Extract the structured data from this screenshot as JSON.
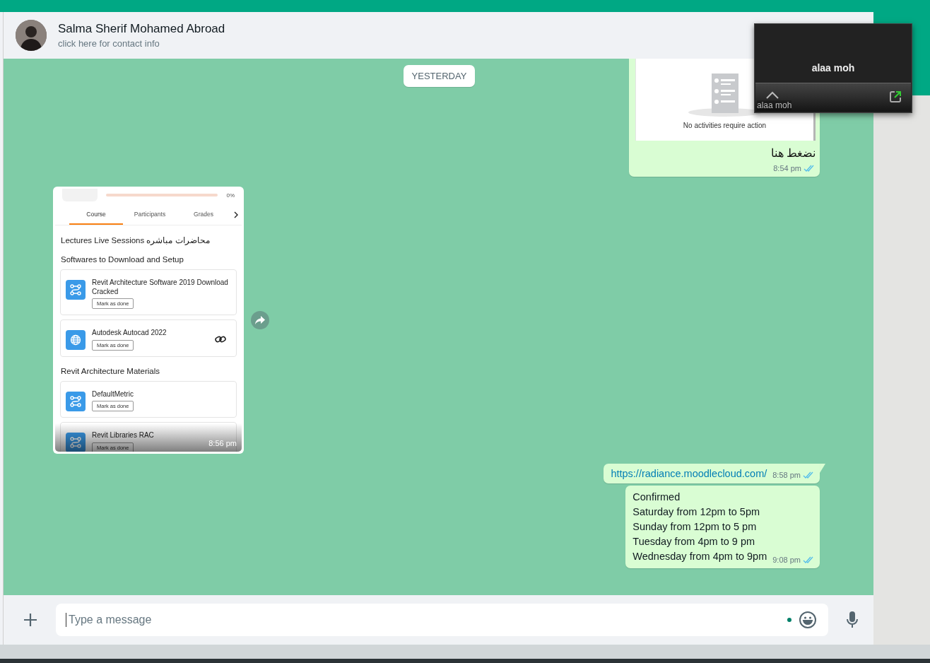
{
  "header": {
    "name": "Salma Sherif Mohamed Abroad",
    "subtitle": "click here for contact info"
  },
  "date_divider": "YESTERDAY",
  "messages": [
    {
      "kind": "image_out",
      "preview_text": "No activities require action",
      "text": "نضغط هنا",
      "time": "8:54 pm",
      "read": true
    },
    {
      "kind": "course_screenshot",
      "time": "8:56 pm",
      "screenshot": {
        "progress": {
          "level": 0,
          "reading": "0%"
        },
        "tabs": [
          {
            "label": "Course",
            "selected": true
          },
          {
            "label": "Participants",
            "selected": false
          },
          {
            "label": "Grades",
            "selected": false
          }
        ],
        "sections": [
          {
            "title": "Lectures Live Sessions محاضرات مباشره"
          },
          {
            "title": "Softwares to Download and Setup",
            "items": [
              {
                "name": "Revit Architecture Software 2019 Download Cracked",
                "kind": "route",
                "button": "Mark as done",
                "link": false
              },
              {
                "name": "Autodesk Autocad 2022",
                "kind": "globe",
                "button": "Mark as done",
                "link": true
              }
            ]
          },
          {
            "title": "Revit Architecture Materials",
            "items": [
              {
                "name": "DefaultMetric",
                "kind": "route",
                "button": "Mark as done",
                "link": false
              },
              {
                "name": "Revit Libraries RAC",
                "kind": "route",
                "button": "Mark as done",
                "link": false
              }
            ]
          }
        ]
      }
    },
    {
      "kind": "link",
      "text": "https://radiance.moodlecloud.com/",
      "time": "8:58 pm",
      "read": true
    },
    {
      "kind": "text",
      "lines": [
        "Confirmed",
        "Saturday from 12pm to 5pm",
        "Sunday from 12pm to 5 pm",
        "Tuesday from 4pm to 9 pm",
        "Wednesday from 4pm to 9pm"
      ],
      "time": "9:08 pm",
      "read": true
    }
  ],
  "composer": {
    "placeholder": "Type a message"
  },
  "call_window": {
    "caller": "alaa moh",
    "caption": "alaa moh"
  }
}
